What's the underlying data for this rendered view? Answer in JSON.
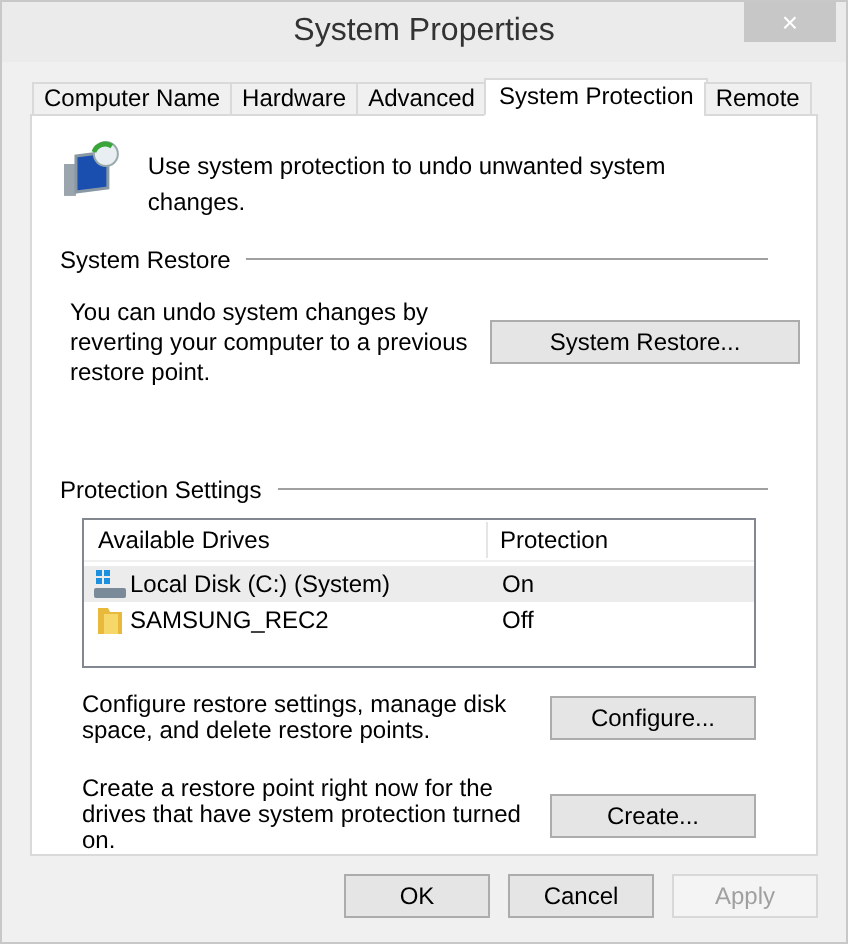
{
  "window": {
    "title": "System Properties",
    "close": "×"
  },
  "tabs": [
    {
      "label": "Computer Name",
      "selected": false
    },
    {
      "label": "Hardware",
      "selected": false
    },
    {
      "label": "Advanced",
      "selected": false
    },
    {
      "label": "System Protection",
      "selected": true
    },
    {
      "label": "Remote",
      "selected": false
    }
  ],
  "intro": "Use system protection to undo unwanted system changes.",
  "system_restore": {
    "heading": "System Restore",
    "description": "You can undo system changes by reverting your computer to a previous restore point.",
    "button": "System Restore..."
  },
  "protection_settings": {
    "heading": "Protection Settings",
    "table": {
      "columns": [
        "Available Drives",
        "Protection"
      ],
      "rows": [
        {
          "kind": "system",
          "drive": "Local Disk (C:) (System)",
          "protection": "On",
          "selected": true
        },
        {
          "kind": "folder",
          "drive": "SAMSUNG_REC2",
          "protection": "Off",
          "selected": false
        }
      ]
    },
    "actions": [
      {
        "text": "Configure restore settings, manage disk space, and delete restore points.",
        "button": "Configure..."
      },
      {
        "text": "Create a restore point right now for the drives that have system protection turned on.",
        "button": "Create..."
      }
    ]
  },
  "buttons": [
    {
      "label": "OK",
      "disabled": false
    },
    {
      "label": "Cancel",
      "disabled": false
    },
    {
      "label": "Apply",
      "disabled": true
    }
  ]
}
